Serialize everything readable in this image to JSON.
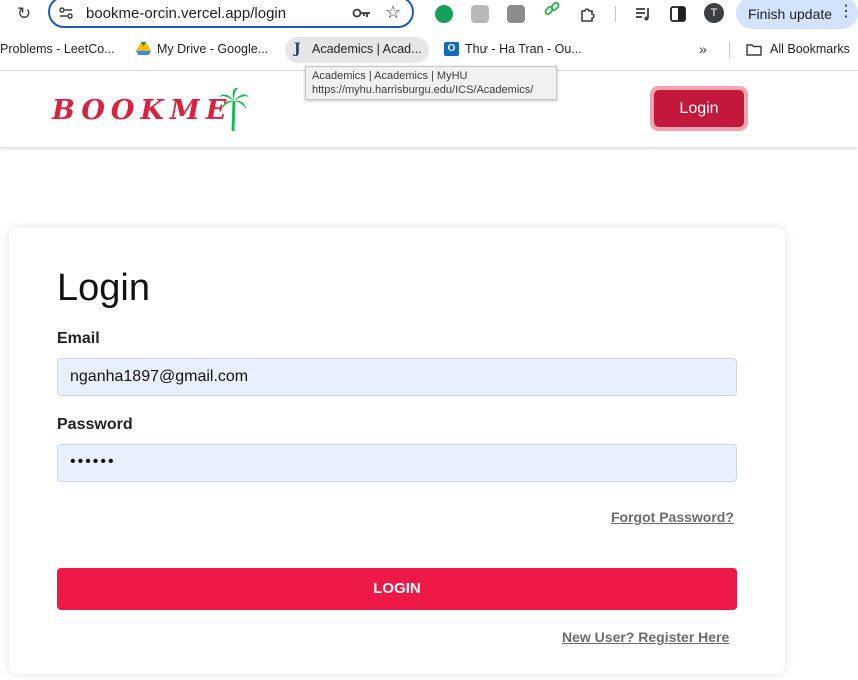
{
  "browser": {
    "url": "bookme-orcin.vercel.app/login",
    "profile_initial": "T",
    "update_button": "Finish update",
    "bookmarks": [
      {
        "label": "Problems - LeetCo...",
        "icon": "leetcode-icon"
      },
      {
        "label": "My Drive - Google...",
        "icon": "google-drive-icon"
      },
      {
        "label": "Academics | Acad...",
        "icon": "jenzabar-icon"
      },
      {
        "label": "Thư - Ha Tran - Ou...",
        "icon": "outlook-icon"
      }
    ],
    "more_bookmarks": "»",
    "all_bookmarks": "All Bookmarks",
    "tooltip": {
      "title": "Academics | Academics | MyHU",
      "url": "https://myhu.harrisburgu.edu/ICS/Academics/"
    },
    "drive_icon_glyph": "▲",
    "jenzabar_glyph": "J",
    "outlook_glyph": "O"
  },
  "site": {
    "logo": "BOOKME",
    "header_login": "Login"
  },
  "form": {
    "title": "Login",
    "email_label": "Email",
    "email_value": "nganha1897@gmail.com",
    "password_label": "Password",
    "password_value": "••••••",
    "forgot_link": "Forgot Password?",
    "submit_label": "LOGIN",
    "register_link": "New User? Register Here"
  },
  "colors": {
    "brand_red": "#d6233f",
    "header_button": "#c1183b",
    "submit_button": "#ef1948",
    "input_bg": "#e8f0fe",
    "palm": "#1db954"
  }
}
